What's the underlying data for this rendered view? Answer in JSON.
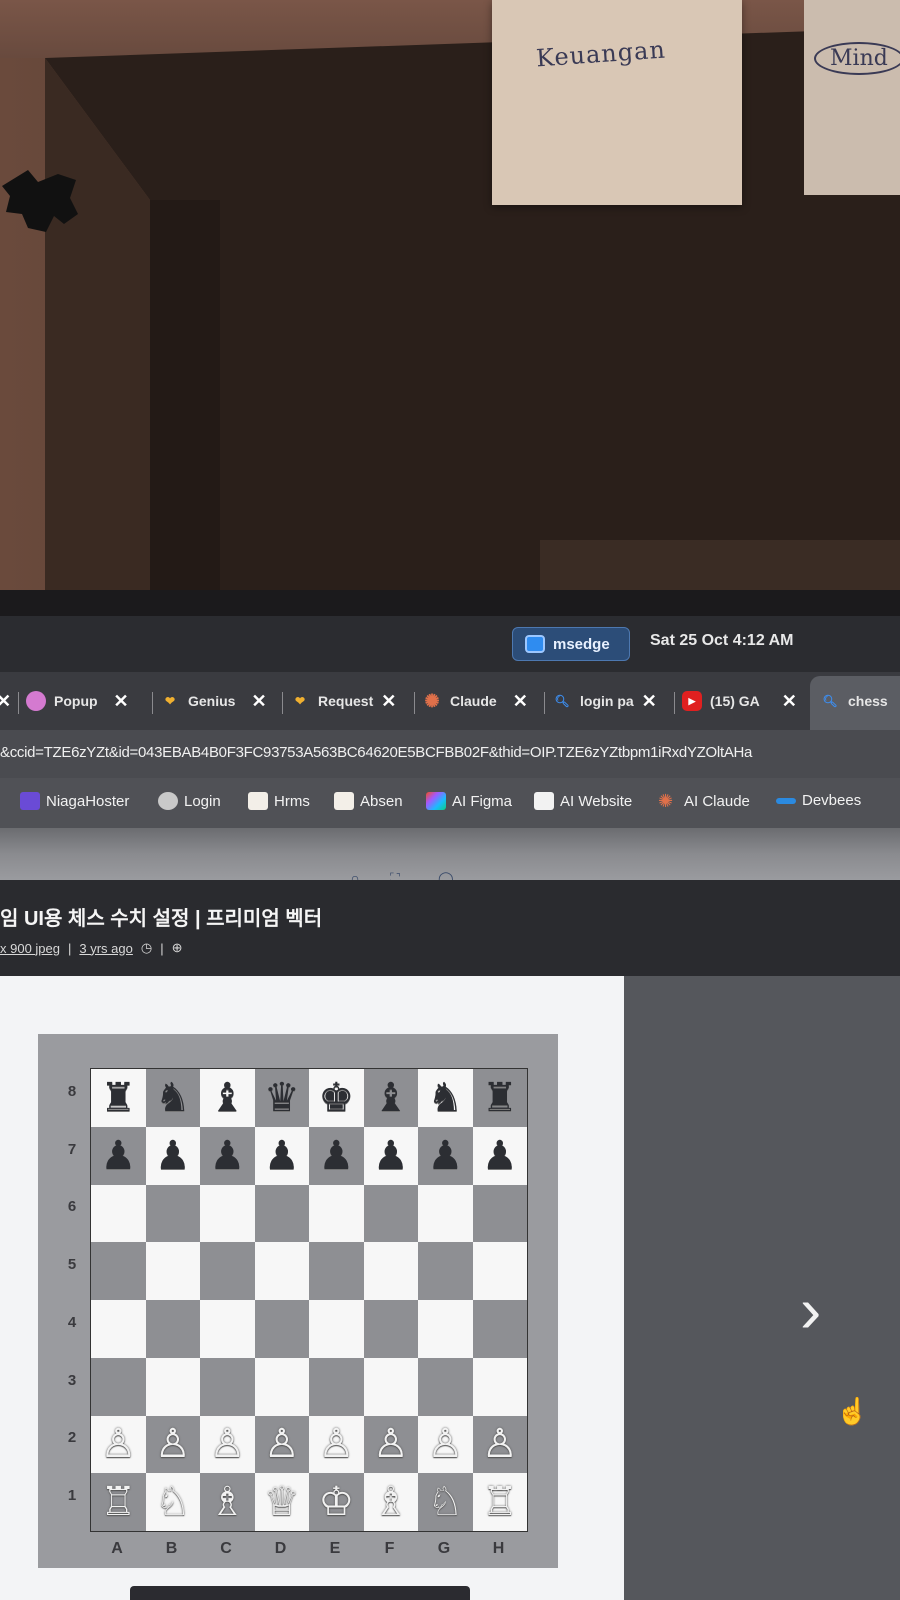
{
  "room": {
    "post_it_1": "Keuangan",
    "post_it_2": "Mind"
  },
  "taskbar": {
    "app_label": "msedge",
    "clock": "Sat 25 Oct 4:12 AM",
    "accent": "#2c4d78"
  },
  "tabs": [
    {
      "label": "Popup",
      "icon": "popup-icon"
    },
    {
      "label": "Genius",
      "icon": "genius-icon"
    },
    {
      "label": "Request",
      "icon": "request-icon"
    },
    {
      "label": "Claude",
      "icon": "claude-icon"
    },
    {
      "label": "login pa",
      "icon": "search-icon"
    },
    {
      "label": "(15) GA",
      "icon": "youtube-icon"
    },
    {
      "label": "chess",
      "icon": "search-icon",
      "active": true
    }
  ],
  "address": {
    "url": "&ccid=TZE6zYZt&id=043EBAB4B0F3FC93753A563BC64620E5BCFBB02F&thid=OIP.TZE6zYZtbpm1iRxdYZOltAHa"
  },
  "bookmarks": [
    {
      "label": "NiagaHoster",
      "icon": "niagahoster-icon"
    },
    {
      "label": "Login",
      "icon": "login-icon"
    },
    {
      "label": "Hrms",
      "icon": "hrms-icon"
    },
    {
      "label": "Absen",
      "icon": "absen-icon"
    },
    {
      "label": "AI Figma",
      "icon": "figma-icon"
    },
    {
      "label": "AI Website",
      "icon": "website-icon"
    },
    {
      "label": "AI Claude",
      "icon": "claude-icon"
    },
    {
      "label": "Devbees",
      "icon": "devbees-icon"
    }
  ],
  "viewer": {
    "title": "임 UI용 체스 수치 설정 | 프리미엄 벡터",
    "size": "x 900 jpeg",
    "age": "3 yrs ago"
  },
  "chess": {
    "ranks": [
      "8",
      "7",
      "6",
      "5",
      "4",
      "3",
      "2",
      "1"
    ],
    "files": [
      "A",
      "B",
      "C",
      "D",
      "E",
      "F",
      "G",
      "H"
    ],
    "rows": [
      [
        "♜",
        "♞",
        "♝",
        "♛",
        "♚",
        "♝",
        "♞",
        "♜"
      ],
      [
        "♟",
        "♟",
        "♟",
        "♟",
        "♟",
        "♟",
        "♟",
        "♟"
      ],
      [
        "",
        "",
        "",
        "",
        "",
        "",
        "",
        ""
      ],
      [
        "",
        "",
        "",
        "",
        "",
        "",
        "",
        ""
      ],
      [
        "",
        "",
        "",
        "",
        "",
        "",
        "",
        ""
      ],
      [
        "",
        "",
        "",
        "",
        "",
        "",
        "",
        ""
      ],
      [
        "♙",
        "♙",
        "♙",
        "♙",
        "♙",
        "♙",
        "♙",
        "♙"
      ],
      [
        "♖",
        "♘",
        "♗",
        "♕",
        "♔",
        "♗",
        "♘",
        "♖"
      ]
    ]
  }
}
